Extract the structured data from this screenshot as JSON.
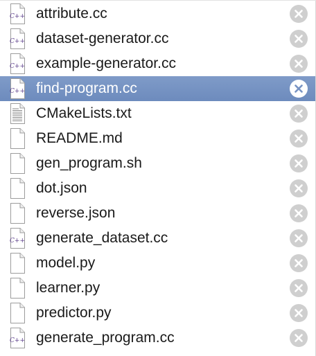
{
  "files": [
    {
      "name": "attribute.cc",
      "icon": "cpp-file-icon",
      "selected": false
    },
    {
      "name": "dataset-generator.cc",
      "icon": "cpp-file-icon",
      "selected": false
    },
    {
      "name": "example-generator.cc",
      "icon": "cpp-file-icon",
      "selected": false
    },
    {
      "name": "find-program.cc",
      "icon": "cpp-file-icon",
      "selected": true
    },
    {
      "name": "CMakeLists.txt",
      "icon": "text-file-icon",
      "selected": false
    },
    {
      "name": "README.md",
      "icon": "blank-file-icon",
      "selected": false
    },
    {
      "name": "gen_program.sh",
      "icon": "blank-file-icon",
      "selected": false
    },
    {
      "name": "dot.json",
      "icon": "blank-file-icon",
      "selected": false
    },
    {
      "name": "reverse.json",
      "icon": "blank-file-icon",
      "selected": false
    },
    {
      "name": "generate_dataset.cc",
      "icon": "cpp-file-icon",
      "selected": false
    },
    {
      "name": "model.py",
      "icon": "blank-file-icon",
      "selected": false
    },
    {
      "name": "learner.py",
      "icon": "blank-file-icon",
      "selected": false
    },
    {
      "name": "predictor.py",
      "icon": "blank-file-icon",
      "selected": false
    },
    {
      "name": "generate_program.cc",
      "icon": "cpp-file-icon",
      "selected": false
    }
  ],
  "cpp_icon_text": "C++",
  "colors": {
    "selection": "#7893c3",
    "close_button": "#cfcfcf",
    "cpp_label": "#5b3d8a"
  }
}
